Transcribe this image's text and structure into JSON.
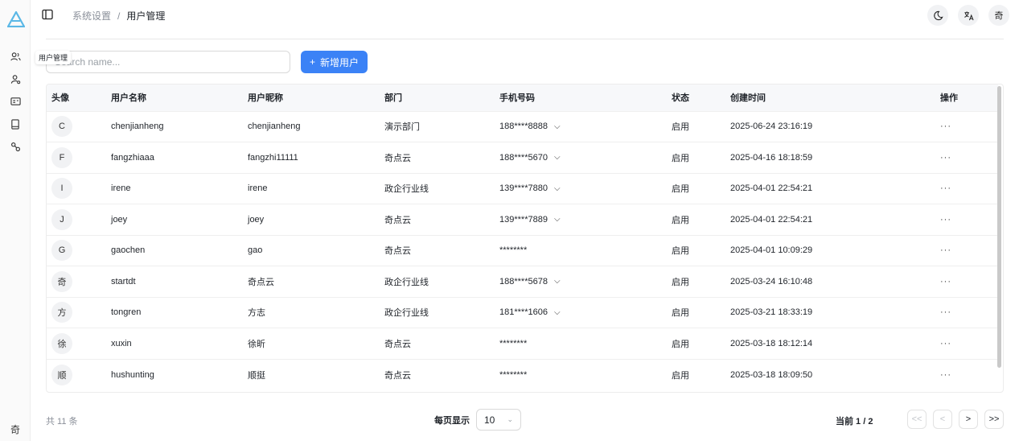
{
  "app": {
    "brand_color": "#3b82f6"
  },
  "sidebar": {
    "items": [
      {
        "icon": "users-icon"
      },
      {
        "icon": "user-settings-icon"
      },
      {
        "icon": "id-card-icon"
      },
      {
        "icon": "book-icon"
      },
      {
        "icon": "link-icon"
      }
    ],
    "user_initial": "奇"
  },
  "tooltip": {
    "text": "用户管理"
  },
  "breadcrumb": {
    "parent": "系统设置",
    "separator": "/",
    "current": "用户管理"
  },
  "header": {
    "user_initial": "奇"
  },
  "search": {
    "placeholder": "Search name...",
    "value": ""
  },
  "toolbar": {
    "add_label": "新增用户",
    "add_icon": "+"
  },
  "table": {
    "columns": [
      "头像",
      "用户名称",
      "用户昵称",
      "部门",
      "手机号码",
      "状态",
      "创建时间",
      "操作"
    ],
    "rows": [
      {
        "avatar": "C",
        "name": "chenjianheng",
        "nickname": "chenjianheng",
        "dept": "演示部门",
        "phone": "188****8888",
        "eye": true,
        "status": "启用",
        "created": "2025-06-24 23:16:19",
        "action": "···"
      },
      {
        "avatar": "F",
        "name": "fangzhiaaa",
        "nickname": "fangzhi11111",
        "dept": "奇点云",
        "phone": "188****5670",
        "eye": true,
        "status": "启用",
        "created": "2025-04-16 18:18:59",
        "action": "···"
      },
      {
        "avatar": "I",
        "name": "irene",
        "nickname": "irene",
        "dept": "政企行业线",
        "phone": "139****7880",
        "eye": true,
        "status": "启用",
        "created": "2025-04-01 22:54:21",
        "action": "···"
      },
      {
        "avatar": "J",
        "name": "joey",
        "nickname": "joey",
        "dept": "奇点云",
        "phone": "139****7889",
        "eye": true,
        "status": "启用",
        "created": "2025-04-01 22:54:21",
        "action": "···"
      },
      {
        "avatar": "G",
        "name": "gaochen",
        "nickname": "gao",
        "dept": "奇点云",
        "phone": "********",
        "eye": false,
        "status": "启用",
        "created": "2025-04-01 10:09:29",
        "action": "···"
      },
      {
        "avatar": "奇",
        "name": "startdt",
        "nickname": "奇点云",
        "dept": "政企行业线",
        "phone": "188****5678",
        "eye": true,
        "status": "启用",
        "created": "2025-03-24 16:10:48",
        "action": "···"
      },
      {
        "avatar": "方",
        "name": "tongren",
        "nickname": "方志",
        "dept": "政企行业线",
        "phone": "181****1606",
        "eye": true,
        "status": "启用",
        "created": "2025-03-21 18:33:19",
        "action": "···"
      },
      {
        "avatar": "徐",
        "name": "xuxin",
        "nickname": "徐昕",
        "dept": "奇点云",
        "phone": "********",
        "eye": false,
        "status": "启用",
        "created": "2025-03-18 18:12:14",
        "action": "···"
      },
      {
        "avatar": "顺",
        "name": "hushunting",
        "nickname": "顺挺",
        "dept": "奇点云",
        "phone": "********",
        "eye": false,
        "status": "启用",
        "created": "2025-03-18 18:09:50",
        "action": "···"
      }
    ]
  },
  "footer": {
    "total": "共 11 条",
    "page_size_label": "每页显示",
    "page_size": "10",
    "current": "当前 1 / 2",
    "pager": [
      "<<",
      "<",
      ">",
      ">>"
    ]
  }
}
